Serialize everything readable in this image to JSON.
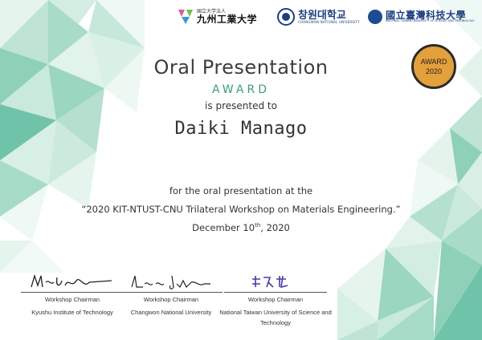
{
  "logos": {
    "kit": {
      "sub": "国立大学法人",
      "main": "九州工業大学"
    },
    "cnu": {
      "main": "창원대학교",
      "sub": "CHANGWON NATIONAL UNIVERSITY"
    },
    "ntust": {
      "main": "國立臺灣科技大學",
      "sub": "NATIONAL TAIWAN UNIVERSITY OF SCIENCE AND TECHNOLOGY"
    }
  },
  "badge": {
    "line1": "AWARD",
    "line2": "2020"
  },
  "certificate": {
    "title": "Oral Presentation",
    "award_word": "AWARD",
    "presented": "is presented to",
    "recipient": "Daiki Manago",
    "desc1": "for the oral presentation at the",
    "desc2": "“2020 KIT-NTUST-CNU Trilateral Workshop on Materials Engineering.”",
    "date_day": "December 10",
    "date_suffix": "th",
    "date_year": ", 2020"
  },
  "signatures": [
    {
      "role": "Workshop Chairman",
      "org": "Kyushu Institute of Technology"
    },
    {
      "role": "Workshop Chairman",
      "org": "Changwon National University"
    },
    {
      "role": "Workshop Chairman",
      "org": "National Taiwan University of Science and Technology"
    }
  ],
  "colors": {
    "accent": "#3aa07a",
    "badge": "#e4a03a",
    "triangle_dark": "#6fc3a8",
    "triangle_light": "#d6eee5"
  }
}
